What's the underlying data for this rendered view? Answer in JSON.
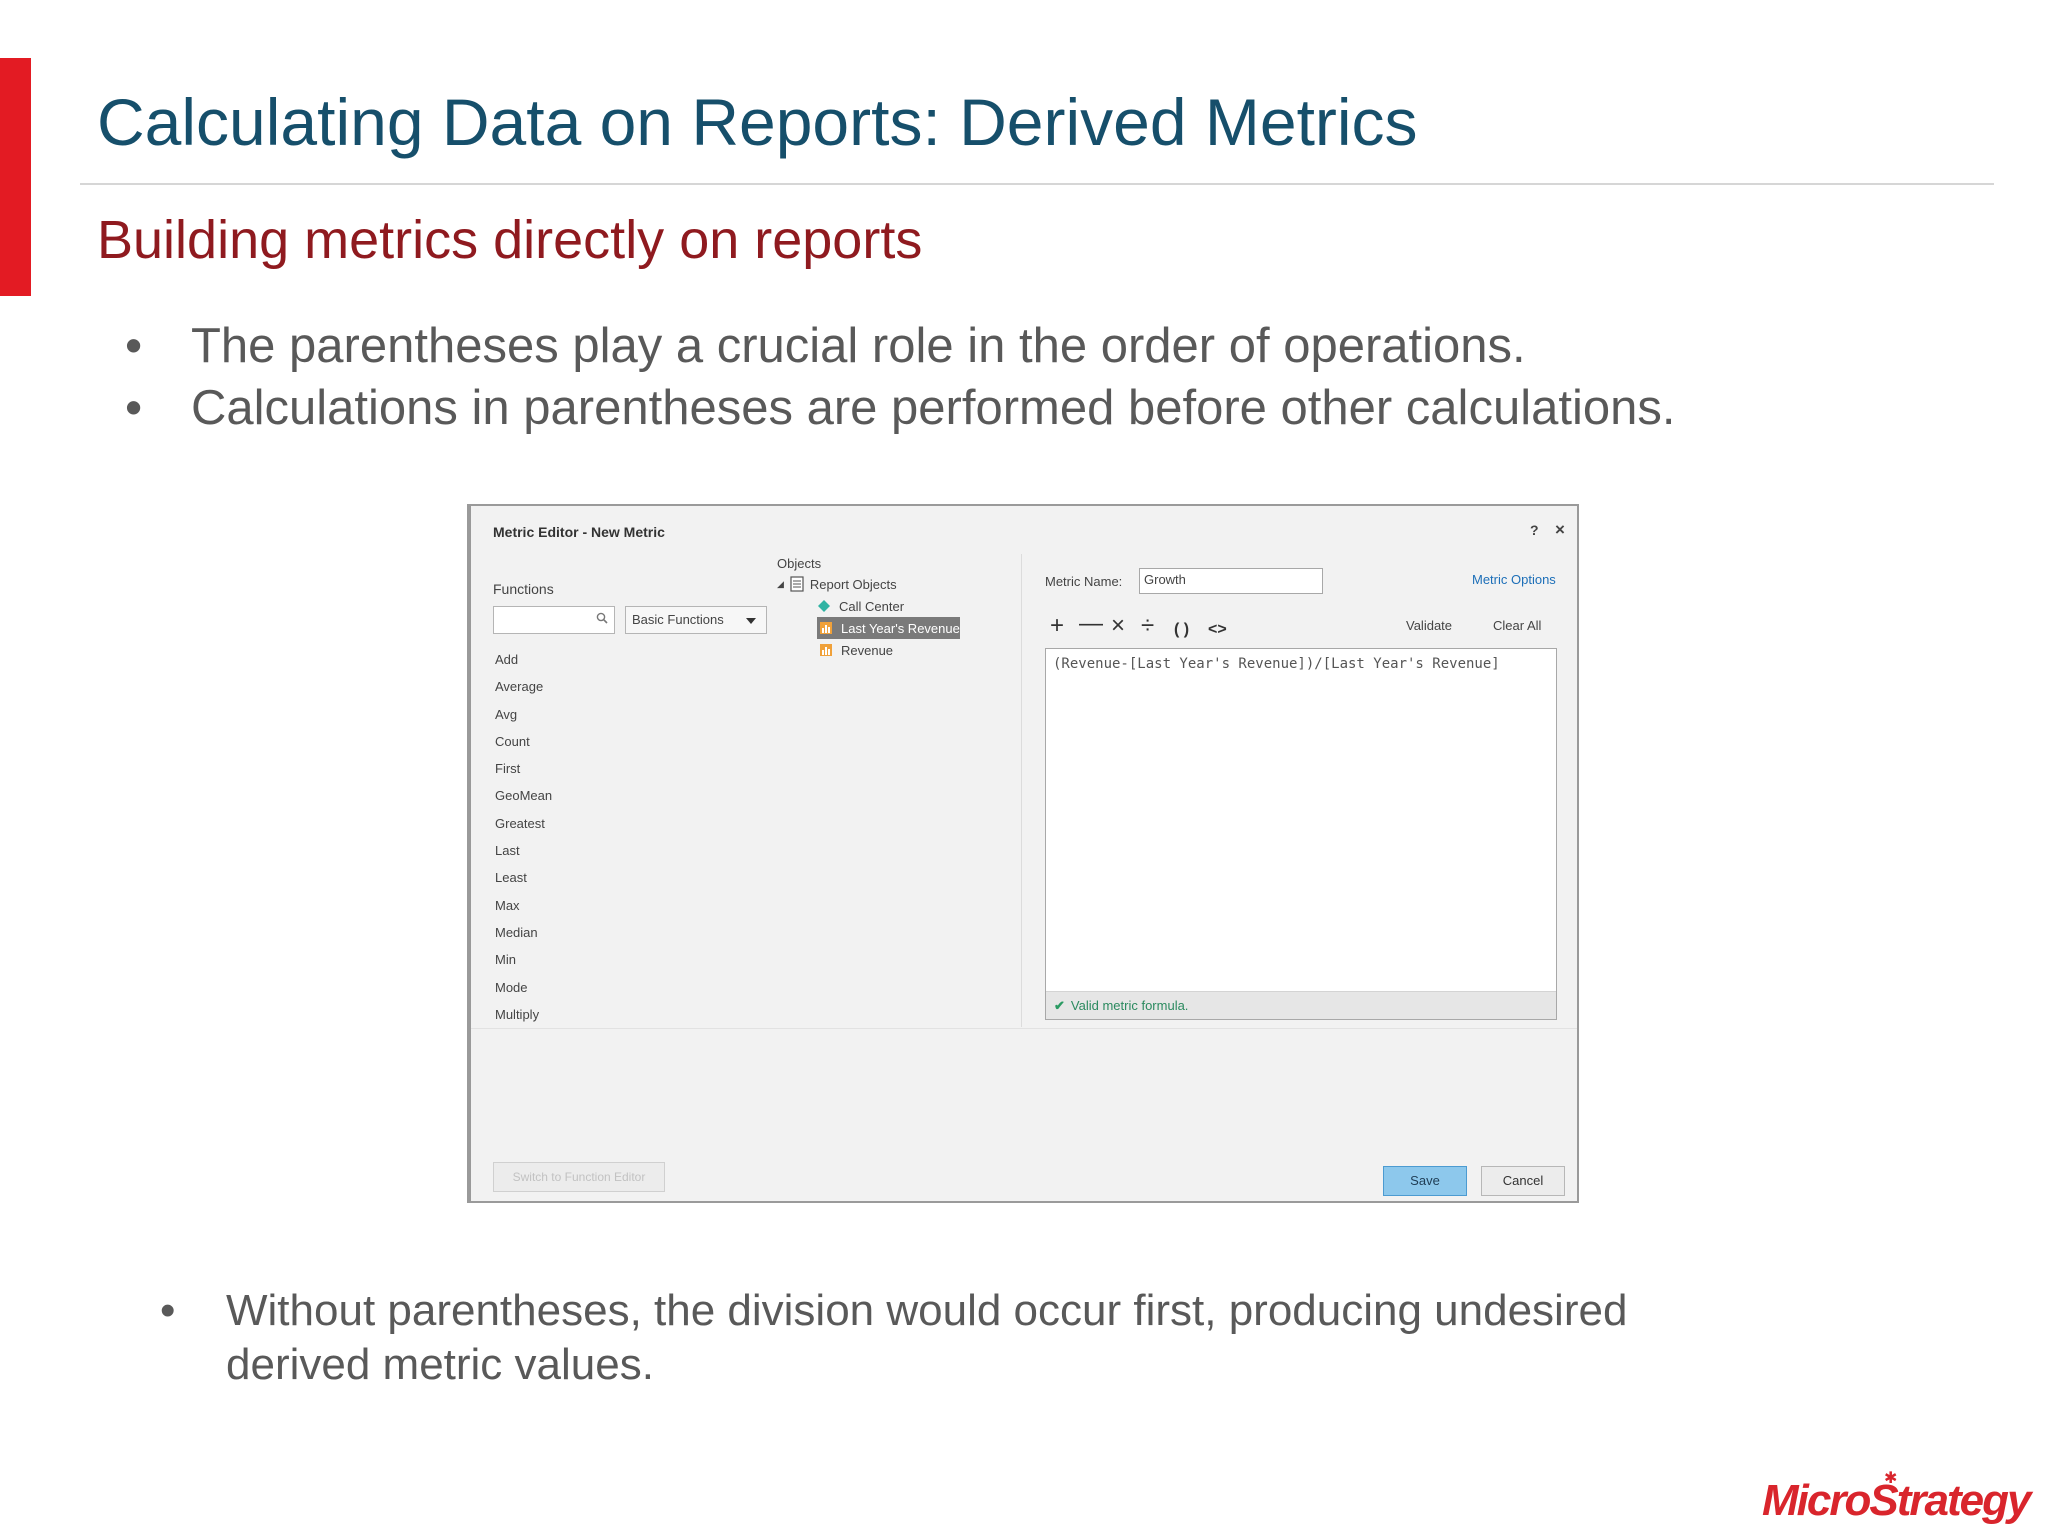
{
  "slide": {
    "title": "Calculating Data on Reports: Derived Metrics",
    "subtitle": "Building metrics directly on reports",
    "bullets": [
      "The parentheses play a crucial role in the order of operations.",
      "Calculations in parentheses are performed before other calculations."
    ],
    "bottom_bullet_line1": "Without parentheses, the division would occur first, producing undesired",
    "bottom_bullet_line2": "derived metric values.",
    "logo": "MicroStrategy",
    "colors": {
      "accent": "#e31b23",
      "title": "#164f6b",
      "subtitle": "#8f1a1f",
      "body": "#595959"
    }
  },
  "dialog": {
    "title": "Metric Editor - New Metric",
    "help": "?",
    "close": "×",
    "functions": {
      "label": "Functions",
      "search_value": "",
      "category_selected": "Basic Functions",
      "items": [
        "Add",
        "Average",
        "Avg",
        "Count",
        "First",
        "GeoMean",
        "Greatest",
        "Last",
        "Least",
        "Max",
        "Median",
        "Min",
        "Mode",
        "Multiply"
      ]
    },
    "objects": {
      "label": "Objects",
      "root": "Report Objects",
      "items": [
        {
          "label": "Call Center",
          "icon": "attribute-diamond-icon"
        },
        {
          "label": "Last Year's Revenue",
          "icon": "metric-icon",
          "selected": true
        },
        {
          "label": "Revenue",
          "icon": "metric-icon"
        }
      ]
    },
    "metric_name_label": "Metric Name:",
    "metric_name_value": "Growth",
    "metric_options": "Metric Options",
    "operators": [
      "+",
      "—",
      "×",
      "÷",
      "( )",
      "<>"
    ],
    "validate": "Validate",
    "clear_all": "Clear All",
    "formula": "(Revenue-[Last Year's Revenue])/[Last Year's Revenue]",
    "status": "Valid metric formula.",
    "switch_button": "Switch to Function Editor",
    "save": "Save",
    "cancel": "Cancel"
  }
}
